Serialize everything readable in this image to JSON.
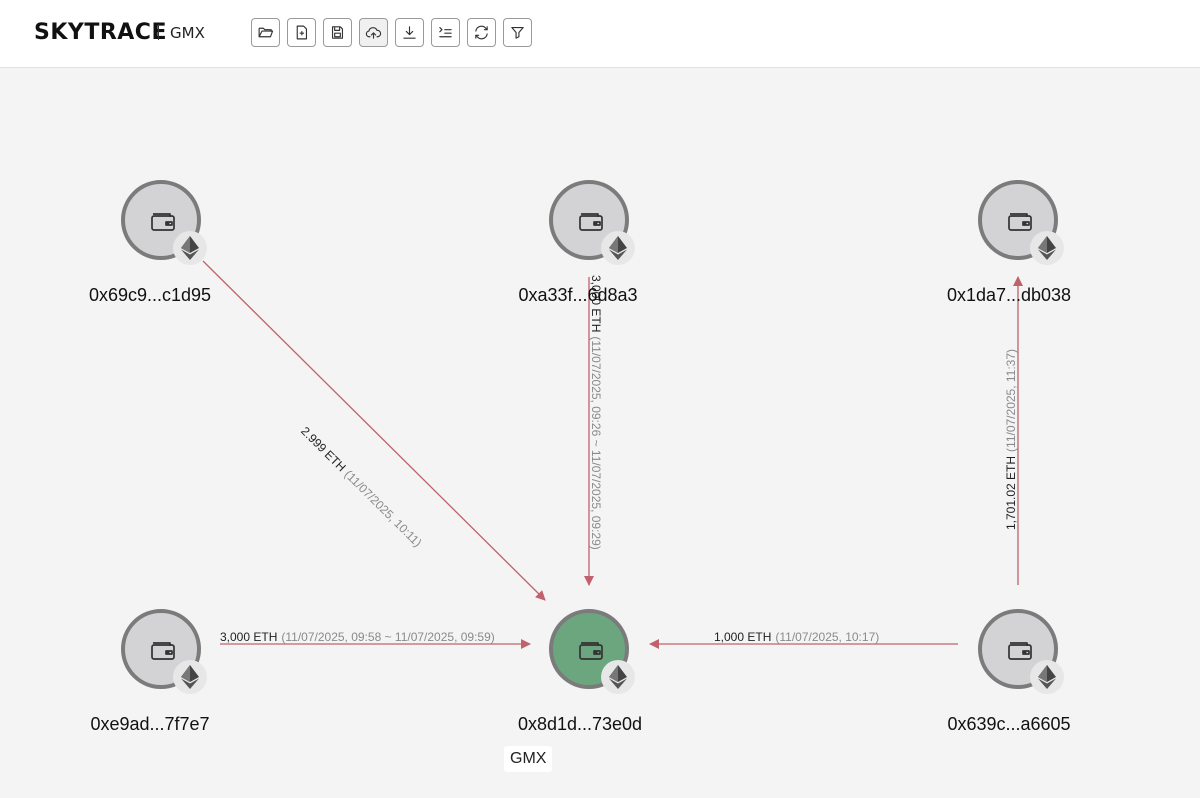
{
  "header": {
    "brand": "SKYTRACE",
    "project": "GMX",
    "tools": [
      {
        "name": "open-folder-icon",
        "label": "Open"
      },
      {
        "name": "new-file-icon",
        "label": "New"
      },
      {
        "name": "save-icon",
        "label": "Save"
      },
      {
        "name": "cloud-upload-icon",
        "label": "Upload"
      },
      {
        "name": "download-icon",
        "label": "Download"
      },
      {
        "name": "list-indent-icon",
        "label": "Layout"
      },
      {
        "name": "refresh-icon",
        "label": "Refresh"
      },
      {
        "name": "filter-icon",
        "label": "Filter"
      }
    ]
  },
  "nodes": {
    "n1": {
      "address": "0x69c9...c1d95"
    },
    "n2": {
      "address": "0xa33f...6d8a3"
    },
    "n3": {
      "address": "0x1da7...db038"
    },
    "n4": {
      "address": "0xe9ad...7f7e7"
    },
    "n5": {
      "address": "0x8d1d...73e0d",
      "tag": "GMX"
    },
    "n6": {
      "address": "0x639c...a6605"
    }
  },
  "edges": {
    "e1": {
      "amount": "2.999 ETH",
      "time": "(11/07/2025, 10:11)"
    },
    "e2": {
      "amount": "3,000 ETH",
      "time": "(11/07/2025, 09:26 ~ 11/07/2025, 09:29)"
    },
    "e3": {
      "amount": "1,701.02 ETH",
      "time": "(11/07/2025, 11:37)"
    },
    "e4": {
      "amount": "3,000 ETH",
      "time": "(11/07/2025, 09:58 ~ 11/07/2025, 09:59)"
    },
    "e5": {
      "amount": "1,000 ETH",
      "time": "(11/07/2025, 10:17)"
    }
  },
  "colors": {
    "edge": "#c0626d",
    "center_node": "#6ba67f",
    "node": "#d3d3d5",
    "node_border": "#7b7b7b"
  }
}
